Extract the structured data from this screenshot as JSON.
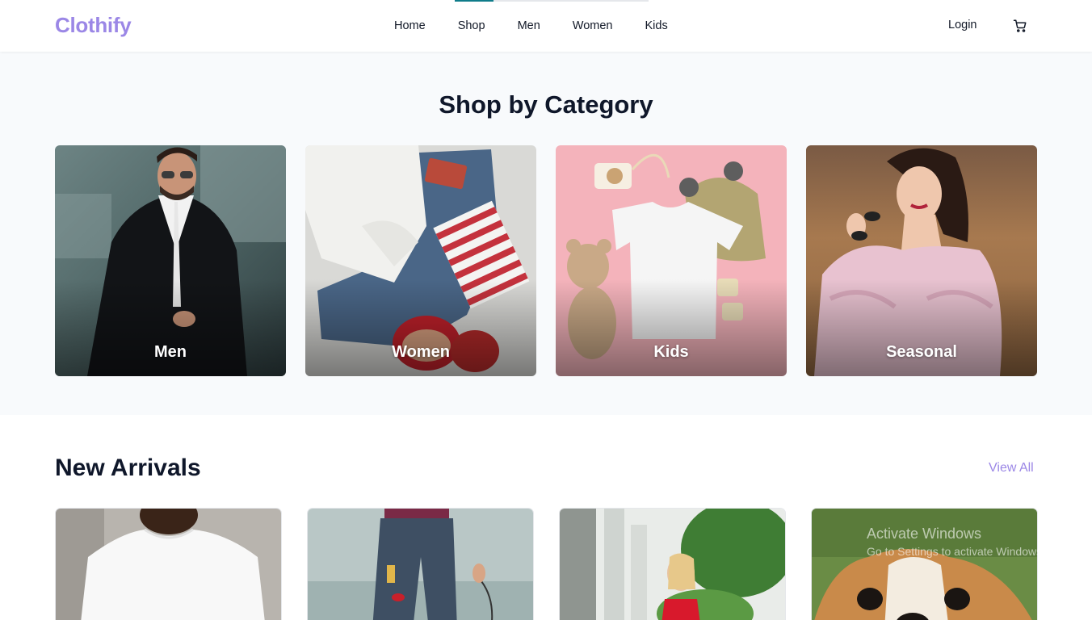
{
  "brand": {
    "logo": "Clothify",
    "accent": "#9b87e6",
    "active_tab_color": "#0f7c8a"
  },
  "nav": {
    "items": [
      "Home",
      "Shop",
      "Men",
      "Women",
      "Kids"
    ],
    "active": "Shop"
  },
  "header": {
    "login": "Login",
    "cart_icon": "cart-icon"
  },
  "categories": {
    "title": "Shop by Category",
    "items": [
      {
        "label": "Men"
      },
      {
        "label": "Women"
      },
      {
        "label": "Kids"
      },
      {
        "label": "Seasonal"
      }
    ]
  },
  "new_arrivals": {
    "title": "New Arrivals",
    "view_all": "View All"
  },
  "watermark": {
    "title": "Activate Windows",
    "subtitle": "Go to Settings to activate Windows."
  }
}
